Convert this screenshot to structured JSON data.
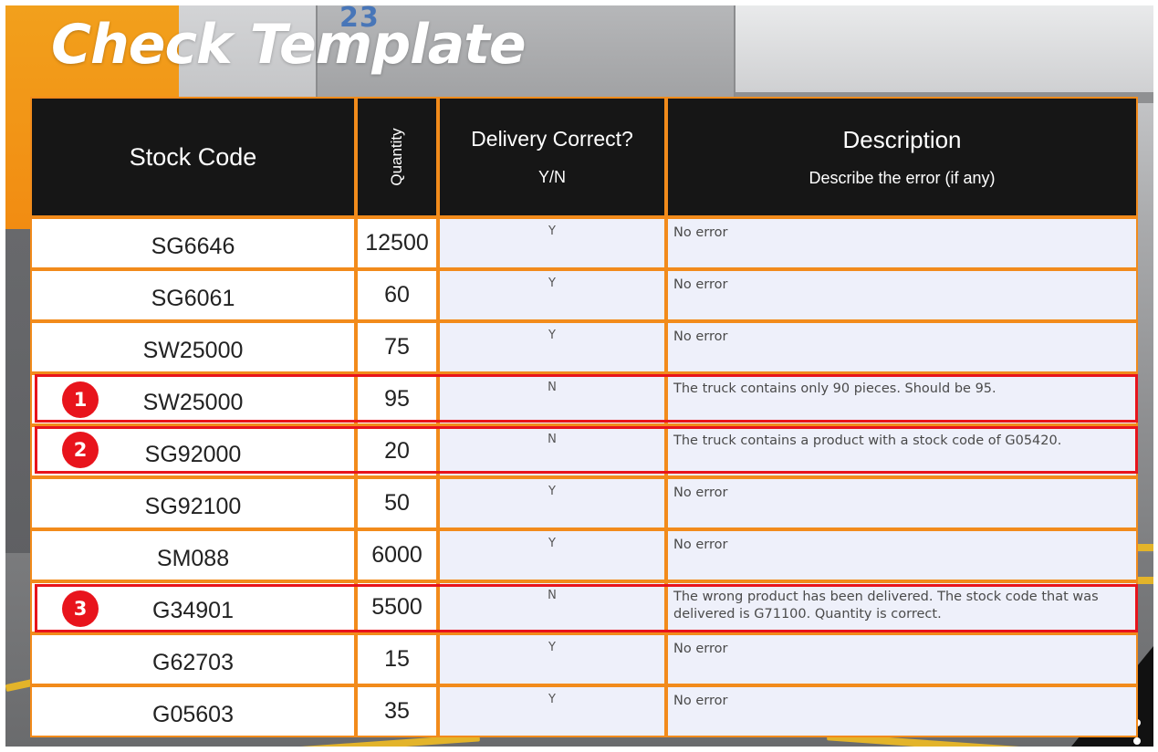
{
  "title": "Check Template",
  "background": {
    "sign_digits": "23",
    "accent_orange": "#f28b1b",
    "header_dark": "#161616",
    "highlight_red": "#e8141c"
  },
  "table": {
    "headers": {
      "stock_code": "Stock Code",
      "quantity": "Quantity",
      "delivery_main": "Delivery Correct?",
      "delivery_sub": "Y/N",
      "description_main": "Description",
      "description_sub": "Describe the error (if any)"
    },
    "rows": [
      {
        "code": "SG6646",
        "qty": "12500",
        "delivery": "Y",
        "description": "No error"
      },
      {
        "code": "SG6061",
        "qty": "60",
        "delivery": "Y",
        "description": "No error"
      },
      {
        "code": "SW25000",
        "qty": "75",
        "delivery": "Y",
        "description": "No error"
      },
      {
        "code": "SW25000",
        "qty": "95",
        "delivery": "N",
        "description": "The truck contains only 90 pieces. Should be 95."
      },
      {
        "code": "SG92000",
        "qty": "20",
        "delivery": "N",
        "description": "The truck contains a product with a stock code of G05420."
      },
      {
        "code": "SG92100",
        "qty": "50",
        "delivery": "Y",
        "description": "No error"
      },
      {
        "code": "SM088",
        "qty": "6000",
        "delivery": "Y",
        "description": "No error"
      },
      {
        "code": "G34901",
        "qty": "5500",
        "delivery": "N",
        "description": "The wrong product has been delivered. The stock code that was delivered is G71100. Quantity is correct."
      },
      {
        "code": "G62703",
        "qty": "15",
        "delivery": "Y",
        "description": "No error"
      },
      {
        "code": "G05603",
        "qty": "35",
        "delivery": "Y",
        "description": "No error"
      }
    ]
  },
  "markers": [
    "1",
    "2",
    "3"
  ]
}
